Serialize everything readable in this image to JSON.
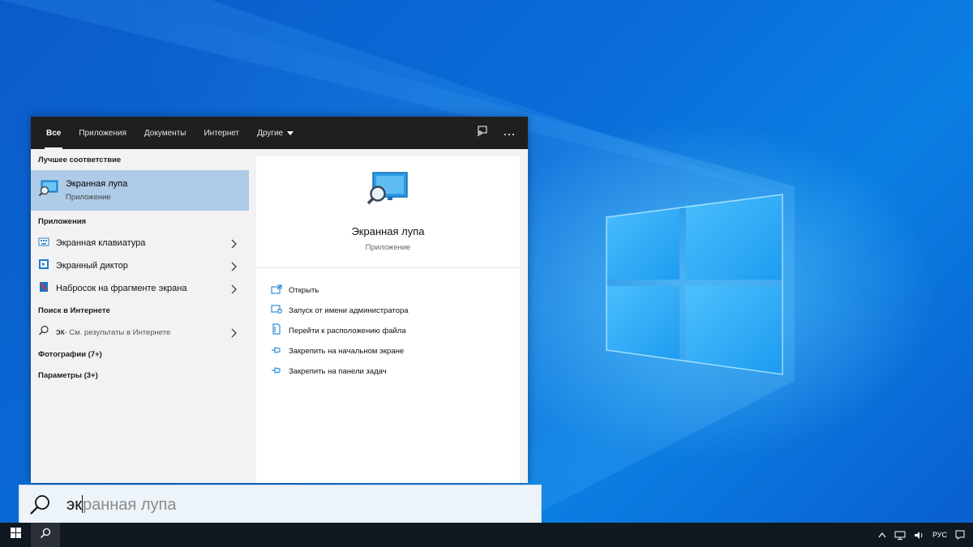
{
  "search_panel": {
    "tabs": [
      {
        "label": "Все",
        "active": true
      },
      {
        "label": "Приложения",
        "active": false
      },
      {
        "label": "Документы",
        "active": false
      },
      {
        "label": "Интернет",
        "active": false
      },
      {
        "label": "Другие",
        "active": false,
        "dropdown": true
      }
    ],
    "header_icons": [
      "feedback-icon",
      "more-options-icon"
    ],
    "best_match_title": "Лучшее соответствие",
    "best_match": {
      "name": "Экранная лупа",
      "type": "Приложение",
      "icon": "magnifier-app-icon"
    },
    "apps_title": "Приложения",
    "apps": [
      {
        "label": "Экранная клавиатура",
        "icon": "on-screen-keyboard-icon"
      },
      {
        "label": "Экранный диктор",
        "icon": "narrator-icon"
      },
      {
        "label": "Набросок на фрагменте экрана",
        "icon": "snip-sketch-icon"
      }
    ],
    "web_title": "Поиск в Интернете",
    "web_result": {
      "query": "эк",
      "hint": " - См. результаты в Интернете",
      "icon": "search-icon"
    },
    "photos_label": "Фотографии (7+)",
    "settings_label": "Параметры (3+)",
    "preview": {
      "name": "Экранная лупа",
      "type": "Приложение",
      "actions": [
        {
          "label": "Открыть",
          "icon": "open-icon"
        },
        {
          "label": "Запуск от имени администратора",
          "icon": "admin-shield-icon"
        },
        {
          "label": "Перейти к расположению файла",
          "icon": "file-location-icon"
        },
        {
          "label": "Закрепить на начальном экране",
          "icon": "pin-icon"
        },
        {
          "label": "Закрепить на панели задач",
          "icon": "pin-icon"
        }
      ]
    }
  },
  "search_box": {
    "typed": "эк",
    "suggestion_rest": "ранная лупа"
  },
  "taskbar": {
    "language": "РУС"
  },
  "colors": {
    "accent": "#0078d7",
    "selection": "#aecbe8",
    "header": "#1f1f1f"
  }
}
